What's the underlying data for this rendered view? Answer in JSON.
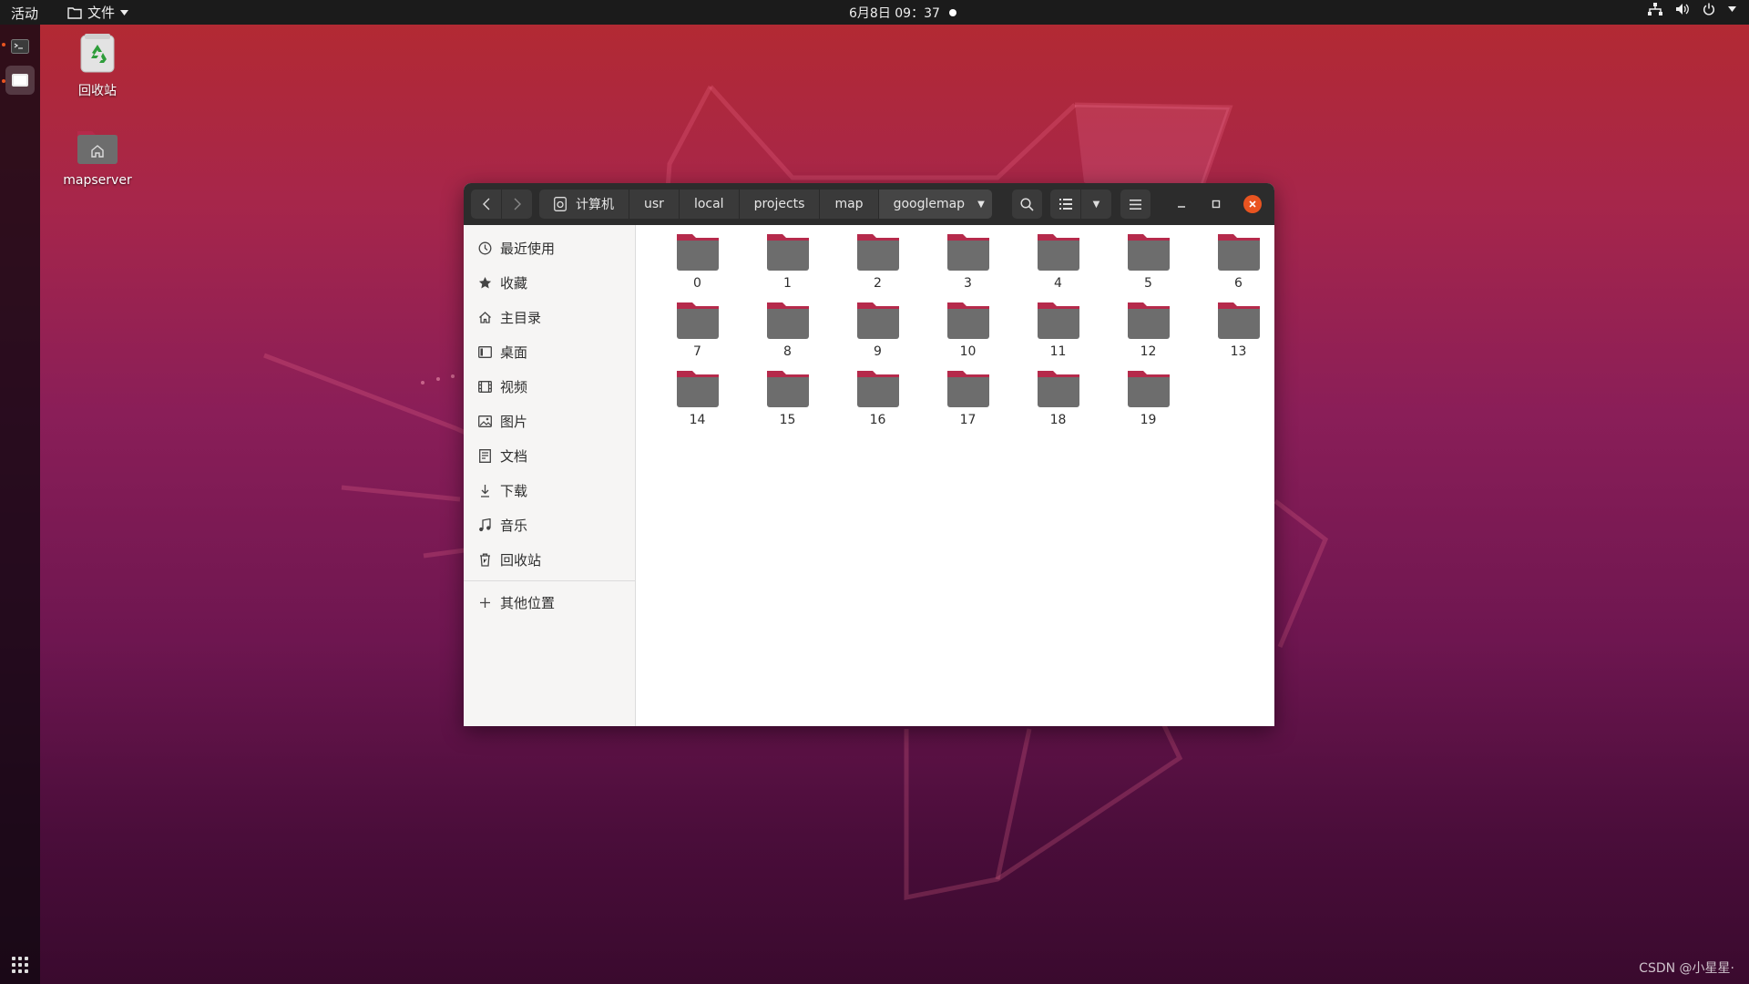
{
  "topbar": {
    "activities": "活动",
    "app_menu": "文件",
    "clock": "6月8日 09：37"
  },
  "desktop": {
    "trash_label": "回收站",
    "home_label": "mapserver"
  },
  "window": {
    "breadcrumbs": [
      "计算机",
      "usr",
      "local",
      "projects",
      "map",
      "googlemap"
    ],
    "sidebar": {
      "recent": "最近使用",
      "starred": "收藏",
      "home": "主目录",
      "desktop": "桌面",
      "videos": "视频",
      "pictures": "图片",
      "documents": "文档",
      "downloads": "下载",
      "music": "音乐",
      "trash": "回收站",
      "other": "其他位置"
    },
    "folders": [
      "0",
      "1",
      "2",
      "3",
      "4",
      "5",
      "6",
      "7",
      "8",
      "9",
      "10",
      "11",
      "12",
      "13",
      "14",
      "15",
      "16",
      "17",
      "18",
      "19"
    ]
  },
  "colors": {
    "accent": "#e95420",
    "folder_body": "#6d6d6d",
    "folder_tab": "#b52a4b"
  },
  "watermark": "CSDN @小星星·"
}
